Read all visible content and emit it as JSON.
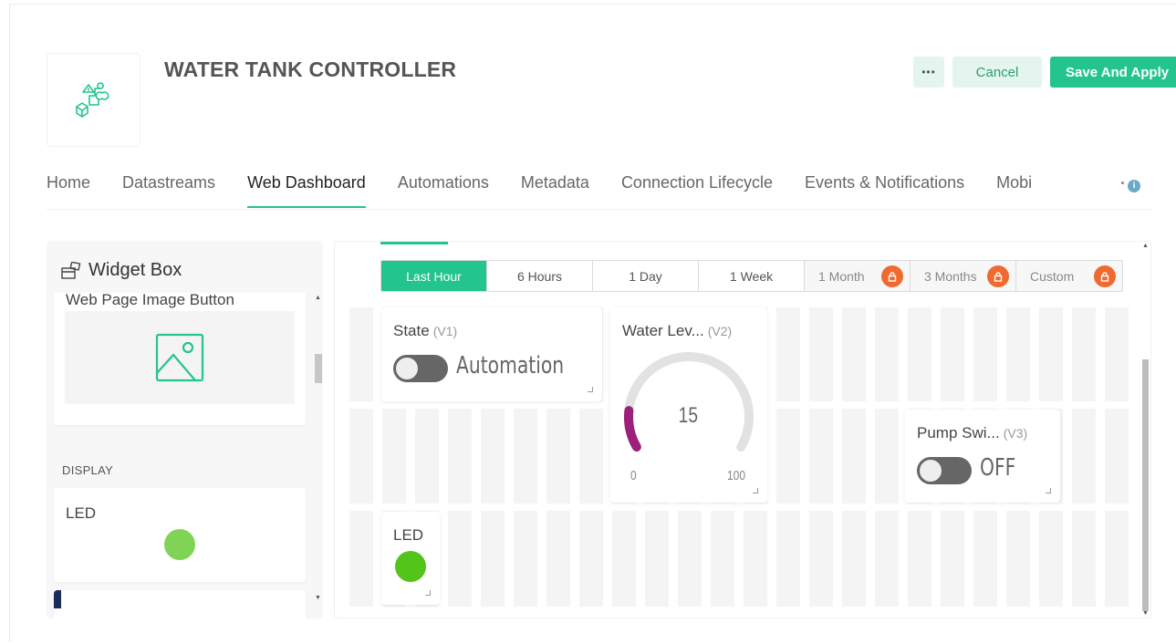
{
  "header": {
    "title": "WATER TANK CONTROLLER",
    "more_label": "•••",
    "cancel_label": "Cancel",
    "save_label": "Save And Apply"
  },
  "tabs": [
    {
      "label": "Home",
      "active": false
    },
    {
      "label": "Datastreams",
      "active": false
    },
    {
      "label": "Web Dashboard",
      "active": true
    },
    {
      "label": "Automations",
      "active": false
    },
    {
      "label": "Metadata",
      "active": false
    },
    {
      "label": "Connection Lifecycle",
      "active": false
    },
    {
      "label": "Events & Notifications",
      "active": false
    },
    {
      "label": "Mobi",
      "active": false
    }
  ],
  "widget_box": {
    "title": "Widget Box",
    "items": {
      "image_button": "Web Page Image Button",
      "section_display": "DISPLAY",
      "led": "LED"
    }
  },
  "time_range": {
    "options": [
      {
        "label": "Last Hour",
        "active": true,
        "locked": false
      },
      {
        "label": "6 Hours",
        "active": false,
        "locked": false
      },
      {
        "label": "1 Day",
        "active": false,
        "locked": false
      },
      {
        "label": "1 Week",
        "active": false,
        "locked": false
      },
      {
        "label": "1 Month",
        "active": false,
        "locked": true
      },
      {
        "label": "3 Months",
        "active": false,
        "locked": true
      },
      {
        "label": "Custom",
        "active": false,
        "locked": true
      }
    ]
  },
  "widgets": {
    "state": {
      "title": "State",
      "pin": "(V1)",
      "switch_label": "Automation",
      "on": false
    },
    "water_level": {
      "title": "Water Lev...",
      "pin": "(V2)",
      "value": 15,
      "min": "0",
      "max": "100",
      "value_text": "15"
    },
    "pump_switch": {
      "title": "Pump Swi...",
      "pin": "(V3)",
      "switch_label": "OFF",
      "on": false
    },
    "led": {
      "title": "LED"
    }
  },
  "colors": {
    "accent": "#23c48e",
    "accent_light": "#e3f5ee",
    "gauge_fill": "#9c1f7a",
    "gauge_track": "#e2e2e2",
    "led_on": "#52c41a",
    "lock_badge": "#f06a30"
  }
}
